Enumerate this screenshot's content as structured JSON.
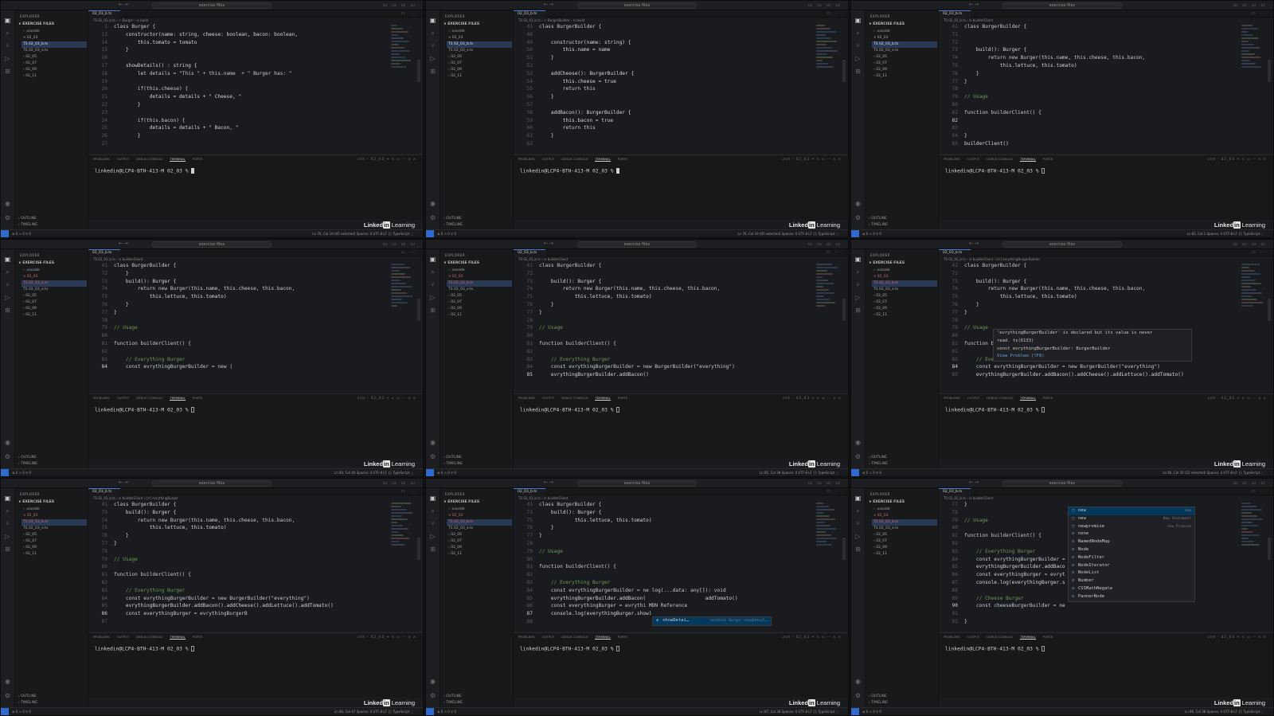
{
  "window": {
    "search_label": "exercise files",
    "nav": "← →",
    "controls": "▭ ▭ ▭ ▭"
  },
  "sidebar": {
    "title": "EXPLORER",
    "section": "∨ EXERCISE FILES",
    "items": [
      "› .vscode",
      "∨ 02_03",
      "TS 02_03_b.ts",
      "TS 02_03_e.ts",
      "› 02_05",
      "› 02_07",
      "› 02_09",
      "› 02_11"
    ],
    "outline": "› OUTLINE",
    "timeline": "› TIMELINE"
  },
  "editor": {
    "tab_label": "02_03_b.ts",
    "tab_ctrls": "▭ ···"
  },
  "bottom_panel": {
    "tabs": [
      "PROBLEMS",
      "OUTPUT",
      "DEBUG CONSOLE",
      "TERMINAL",
      "PORTS"
    ],
    "controls": "zsh - 02_03 + ∨ ▭ ⋯ ∧ ×",
    "prompt": "linkedin@LCP4-BTH-413-M 02_03 % "
  },
  "branding": {
    "linked": "Linked",
    "in": "in",
    "learning": " Learning"
  },
  "statusbar": {
    "remote": "",
    "left": "⊗ 0 ⚠ 0  ⚲ 0",
    "right_suffix": "Spaces: 4   UTF-8   LF   {} TypeScript   ◌"
  },
  "panels": [
    {
      "breadcrumb": "TS 02_03_b.ts › ⚇ Burger › ⊡ build",
      "status_pos": "Ln 76, Col 19 (65 selected)",
      "term_cursor": "solid",
      "lines": [
        {
          "n": "1",
          "t": "class Burger {"
        },
        {
          "n": "13",
          "t": "    constructor(name: string, cheese: boolean, bacon: boolean,"
        },
        {
          "n": "14",
          "t": "        this.tomato = tomato"
        },
        {
          "n": "15",
          "t": "    }"
        },
        {
          "n": "16",
          "t": ""
        },
        {
          "n": "17",
          "t": "    showDetails() : string {"
        },
        {
          "n": "18",
          "t": "        let details = \"This \" + this.name  + \" Burger has: \""
        },
        {
          "n": "19",
          "t": ""
        },
        {
          "n": "20",
          "t": "        if(this.cheese) {"
        },
        {
          "n": "21",
          "t": "            details = details + \" Cheese, \""
        },
        {
          "n": "22",
          "t": "        }"
        },
        {
          "n": "23",
          "t": ""
        },
        {
          "n": "24",
          "t": "        if(this.bacon) {"
        },
        {
          "n": "25",
          "t": "            details = details + \" Bacon, \""
        },
        {
          "n": "26",
          "t": "        }"
        },
        {
          "n": "27",
          "t": ""
        }
      ]
    },
    {
      "breadcrumb": "TS 02_03_b.ts › ⚇ BurgerBuilder › ⊡ build",
      "status_pos": "Ln 76, Col 19 (65 selected)",
      "term_cursor": "solid",
      "lines": [
        {
          "n": "41",
          "t": "class BurgerBuilder {"
        },
        {
          "n": "48",
          "t": ""
        },
        {
          "n": "49",
          "t": "    constructor(name: string) {"
        },
        {
          "n": "50",
          "t": "        this.name = name"
        },
        {
          "n": "51",
          "t": "    }"
        },
        {
          "n": "52",
          "t": ""
        },
        {
          "n": "53",
          "t": "    addCheese(): BurgerBuilder {"
        },
        {
          "n": "54",
          "t": "        this.cheese = true"
        },
        {
          "n": "55",
          "t": "        return this"
        },
        {
          "n": "56",
          "t": "    }"
        },
        {
          "n": "57",
          "t": ""
        },
        {
          "n": "58",
          "t": "    addBacon(): BurgerBuilder {"
        },
        {
          "n": "59",
          "t": "        this.bacon = true"
        },
        {
          "n": "60",
          "t": "        return this"
        },
        {
          "n": "61",
          "t": "    }"
        },
        {
          "n": "62",
          "t": ""
        }
      ]
    },
    {
      "breadcrumb": "TS 02_03_b.ts › ⊡ builderClient",
      "status_pos": "Ln 82, Col 1",
      "term_cursor": "hollow",
      "lines": [
        {
          "n": "41",
          "t": "class BurgerBuilder {"
        },
        {
          "n": "71",
          "t": ""
        },
        {
          "n": "72",
          "t": ""
        },
        {
          "n": "73",
          "t": "    build(): Burger {"
        },
        {
          "n": "74",
          "t": "        return new Burger(this.name, this.cheese, this.bacon,"
        },
        {
          "n": "75",
          "t": "            this.lettuce, this.tomato)"
        },
        {
          "n": "76",
          "t": "    }"
        },
        {
          "n": "77",
          "t": "}"
        },
        {
          "n": "78",
          "t": ""
        },
        {
          "n": "79",
          "t": "// Usage"
        },
        {
          "n": "80",
          "t": ""
        },
        {
          "n": "81",
          "t": "function builderClient() {"
        },
        {
          "n": "82",
          "t": "",
          "cur": true
        },
        {
          "n": "83",
          "t": ""
        },
        {
          "n": "84",
          "t": "}"
        },
        {
          "n": "85",
          "t": "builderClient()"
        }
      ]
    },
    {
      "breadcrumb": "TS 02_03_b.ts › ⊡ builderClient",
      "status_pos": "Ln 84, Col 40",
      "term_cursor": "hollow",
      "lines": [
        {
          "n": "41",
          "t": "class BurgerBuilder {"
        },
        {
          "n": "72",
          "t": "    }"
        },
        {
          "n": "73",
          "t": "    build(): Burger {"
        },
        {
          "n": "74",
          "t": "        return new Burger(this.name, this.cheese, this.bacon,"
        },
        {
          "n": "75",
          "t": "            this.lettuce, this.tomato)"
        },
        {
          "n": "76",
          "t": "    }"
        },
        {
          "n": "77",
          "t": "}"
        },
        {
          "n": "78",
          "t": ""
        },
        {
          "n": "79",
          "t": "// Usage"
        },
        {
          "n": "80",
          "t": ""
        },
        {
          "n": "81",
          "t": "function builderClient() {"
        },
        {
          "n": "82",
          "t": ""
        },
        {
          "n": "83",
          "t": "    // Everything Burger"
        },
        {
          "n": "84",
          "t": "    const evrythingBurgerBuilder = new |",
          "cur": true
        }
      ]
    },
    {
      "breadcrumb": "TS 02_03_b.ts › ⊡ builderClient",
      "status_pos": "Ln 85, Col 38",
      "term_cursor": "hollow",
      "lines": [
        {
          "n": "41",
          "t": "class BurgerBuilder {"
        },
        {
          "n": "72",
          "t": ""
        },
        {
          "n": "73",
          "t": "    build(): Burger {"
        },
        {
          "n": "74",
          "t": "        return new Burger(this.name, this.cheese, this.bacon,"
        },
        {
          "n": "75",
          "t": "            this.lettuce, this.tomato)"
        },
        {
          "n": "76",
          "t": "    }"
        },
        {
          "n": "77",
          "t": "}"
        },
        {
          "n": "78",
          "t": ""
        },
        {
          "n": "79",
          "t": "// Usage"
        },
        {
          "n": "80",
          "t": ""
        },
        {
          "n": "81",
          "t": "function builderClient() {"
        },
        {
          "n": "82",
          "t": ""
        },
        {
          "n": "83",
          "t": "    // Everything Burger"
        },
        {
          "n": "84",
          "t": "    const evrythingBurgerBuilder = new BurgerBuilder(\"everything\")"
        },
        {
          "n": "85",
          "t": "    evrythingBurgerBuilder.addBacon()",
          "cur": true
        }
      ]
    },
    {
      "breadcrumb": "TS 02_03_b.ts › ⊡ builderClient › [∅] evrythingBurgerBuilder",
      "status_pos": "Ln 84, Col 30 (22 selected)",
      "term_cursor": "hollow",
      "lines": [
        {
          "n": "41",
          "t": "class BurgerBuilder {"
        },
        {
          "n": "72",
          "t": ""
        },
        {
          "n": "73",
          "t": "    build(): Burger {"
        },
        {
          "n": "74",
          "t": "        return new Burger(this.name, this.cheese, this.bacon,"
        },
        {
          "n": "75",
          "t": "            this.lettuce, this.tomato)"
        },
        {
          "n": "76",
          "t": "    }"
        },
        {
          "n": "77",
          "t": "}"
        },
        {
          "n": "78",
          "t": ""
        },
        {
          "n": "79",
          "t": "// Usage"
        },
        {
          "n": "80",
          "t": ""
        },
        {
          "n": "81",
          "t": "function b"
        },
        {
          "n": "82",
          "t": ""
        },
        {
          "n": "83",
          "t": "    // Eve"
        },
        {
          "n": "84",
          "t": "    const evrythingBurgerBuilder = new BurgerBuilder(\"everything\")",
          "cur": true
        },
        {
          "n": "85",
          "t": "    evrythingBurgerBuilder.addBacon().addCheese().addLettuce().addTomato()"
        }
      ],
      "hover": [
        "'evrythingBurgerBuilder' is declared but its value is never",
        "read. ts(6133)",
        "const evrythingBurgerBuilder: BurgerBuilder",
        "View Problem (⌥F8)"
      ]
    },
    {
      "breadcrumb": "TS 02_03_b.ts › ⊡ builderClient › [∅] evrythingBurger",
      "status_pos": "Ln 86, Col 47",
      "term_cursor": "hollow",
      "lines": [
        {
          "n": "41",
          "t": "class BurgerBuilder {"
        },
        {
          "n": "73",
          "t": "    build(): Burger {"
        },
        {
          "n": "74",
          "t": "        return new Burger(this.name, this.cheese, this.bacon,"
        },
        {
          "n": "75",
          "t": "            this.lettuce, this.tomato)"
        },
        {
          "n": "76",
          "t": "    }"
        },
        {
          "n": "77",
          "t": "}"
        },
        {
          "n": "78",
          "t": ""
        },
        {
          "n": "79",
          "t": "// Usage"
        },
        {
          "n": "80",
          "t": ""
        },
        {
          "n": "81",
          "t": "function builderClient() {"
        },
        {
          "n": "82",
          "t": ""
        },
        {
          "n": "83",
          "t": "    // Everything Burger"
        },
        {
          "n": "84",
          "t": "    const evrythingBurgerBuilder = new BurgerBuilder(\"everything\")"
        },
        {
          "n": "85",
          "t": "    evrythingBurgerBuilder.addBacon().addCheese().addLettuce().addTomato()"
        },
        {
          "n": "86",
          "t": "    const everythingBurger = evrythingBurgerB",
          "cur": true
        },
        {
          "n": "87",
          "t": ""
        }
      ]
    },
    {
      "breadcrumb": "TS 02_03_b.ts › ⊡ builderClient",
      "status_pos": "Ln 87, Col 38",
      "term_cursor": "hollow",
      "lines": [
        {
          "n": "41",
          "t": "class BurgerBuilder {"
        },
        {
          "n": "73",
          "t": "    build(): Burger {"
        },
        {
          "n": "75",
          "t": "            this.lettuce, this.tomato)"
        },
        {
          "n": "76",
          "t": "    }"
        },
        {
          "n": "77",
          "t": "}"
        },
        {
          "n": "78",
          "t": ""
        },
        {
          "n": "79",
          "t": "// Usage"
        },
        {
          "n": "80",
          "t": ""
        },
        {
          "n": "81",
          "t": "function builderClient() {"
        },
        {
          "n": "82",
          "t": ""
        },
        {
          "n": "83",
          "t": "    // Everything Burger"
        },
        {
          "n": "84",
          "t": "    const evrythingBurgerBuilder = ne log(...data: any[]): void"
        },
        {
          "n": "85",
          "t": "    evrythingBurgerBuilder.addBacon(                    addTomato()"
        },
        {
          "n": "86",
          "t": "    const everythingBurger = evrythi MDN Reference"
        },
        {
          "n": "87",
          "t": "    console.log(everythingBurger.show)",
          "cur": true
        },
        {
          "n": "88",
          "t": ""
        }
      ],
      "suggest": {
        "label": "showDetai…",
        "detail": "(method) Burger.showDetail…"
      }
    },
    {
      "breadcrumb": "TS 02_03_b.ts › ⊡ builderClient",
      "status_pos": "Ln 90, Col 38",
      "term_cursor": "hollow",
      "lines": [
        {
          "n": "77",
          "t": "}"
        },
        {
          "n": "78",
          "t": ""
        },
        {
          "n": "79",
          "t": "// Usage"
        },
        {
          "n": "80",
          "t": ""
        },
        {
          "n": "81",
          "t": "function builderClient() {"
        },
        {
          "n": "82",
          "t": ""
        },
        {
          "n": "83",
          "t": "    // Everything Burger"
        },
        {
          "n": "84",
          "t": "    const evrythingBurgerBuilder = n"
        },
        {
          "n": "85",
          "t": "    evrythingBurgerBuilder.addBaco"
        },
        {
          "n": "86",
          "t": "    const everythingBurger = evryt"
        },
        {
          "n": "87",
          "t": "    console.log(everythingBurger.s"
        },
        {
          "n": "88",
          "t": ""
        },
        {
          "n": "89",
          "t": "    // Cheese Burger"
        },
        {
          "n": "90",
          "t": "    const cheeseBurgerBuilder = ne",
          "cur": true
        },
        {
          "n": "91",
          "t": ""
        },
        {
          "n": "92",
          "t": "}"
        }
      ],
      "completions": [
        {
          "label": "new",
          "detail": "new",
          "sel": true
        },
        {
          "label": "new",
          "detail": "New Statement"
        },
        {
          "label": "newpromise",
          "detail": "new Promise"
        },
        {
          "label": "none",
          "detail": ""
        },
        {
          "label": "NamedNodeMap",
          "detail": ""
        },
        {
          "label": "Node",
          "detail": ""
        },
        {
          "label": "NodeFilter",
          "detail": ""
        },
        {
          "label": "NodeIterator",
          "detail": ""
        },
        {
          "label": "NodeList",
          "detail": ""
        },
        {
          "label": "Number",
          "detail": ""
        },
        {
          "label": "CSSMathNegate",
          "detail": ""
        },
        {
          "label": "PannerNode",
          "detail": ""
        }
      ]
    }
  ]
}
